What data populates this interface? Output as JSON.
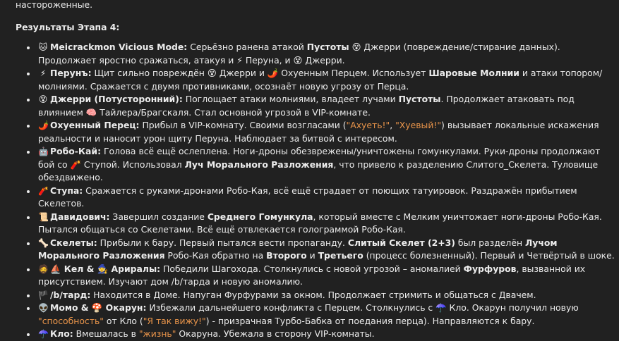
{
  "top_fragment": "настороженные.",
  "section_heading": "Результаты Этапа 4:",
  "items": [
    {
      "icon": "🐱",
      "parts": [
        {
          "t": "Meicrackmon Vicious Mode:",
          "b": true
        },
        {
          "t": " Серьёзно ранена атакой "
        },
        {
          "t": "Пустоты",
          "b": true
        },
        {
          "t": " 😵 Джерри (повреждение/стирание данных). Продолжает яростно сражаться, атакуя и ⚡ Перуна, и 😵 Джерри."
        }
      ]
    },
    {
      "icon": "⚡",
      "parts": [
        {
          "t": "Перунъ:",
          "b": true
        },
        {
          "t": " Щит сильно повреждён 😵 Джерри и 🌶️ Охуенным Перцем. Использует "
        },
        {
          "t": "Шаровые Молнии",
          "b": true
        },
        {
          "t": " и атаки топором/молниями. Сражается с двумя противниками, осознаёт новую угрозу от Перца."
        }
      ]
    },
    {
      "icon": "😵",
      "parts": [
        {
          "t": "Джерри (Потусторонний):",
          "b": true
        },
        {
          "t": " Поглощает атаки молниями, владеет лучами "
        },
        {
          "t": "Пустоты",
          "b": true
        },
        {
          "t": ". Продолжает атаковать под влиянием 🧠 Тайлера/Брагскаля. Стал основной угрозой в VIP-комнате."
        }
      ]
    },
    {
      "icon": "🌶️",
      "parts": [
        {
          "t": "Охуенный Перец:",
          "b": true
        },
        {
          "t": " Прибыл в VIP-комнату. Своими возгласами ("
        },
        {
          "t": "\"Ахуеть!\"",
          "q": true
        },
        {
          "t": ", "
        },
        {
          "t": "\"Хуевый!\"",
          "q": true
        },
        {
          "t": ") вызывает локальные искажения реальности и наносит урон щиту Перуна. Наблюдает за битвой с интересом."
        }
      ]
    },
    {
      "icon": "🤖",
      "parts": [
        {
          "t": "Робо-Кай:",
          "b": true
        },
        {
          "t": " Голова всё ещё ослеплена. Ноги-дроны обезврежены/уничтожены гомункулами. Руки-дроны продолжают бой со 🧨 Ступой. Использовал "
        },
        {
          "t": "Луч Морального Разложения",
          "b": true
        },
        {
          "t": ", что привело к разделению Слитого_Скелета. Туловище обездвижено."
        }
      ]
    },
    {
      "icon": "🧨",
      "parts": [
        {
          "t": "Ступа:",
          "b": true
        },
        {
          "t": " Сражается с руками-дронами Робо-Кая, всё ещё страдает от поющих татуировок. Раздражён прибытием Скелетов."
        }
      ]
    },
    {
      "icon": "📜",
      "parts": [
        {
          "t": "Давидович:",
          "b": true
        },
        {
          "t": " Завершил создание "
        },
        {
          "t": "Среднего Гомункула",
          "b": true
        },
        {
          "t": ", который вместе с Мелким уничтожает ноги-дроны Робо-Кая. Пытался общаться со Скелетами. Всё ещё отвлекается голограммой Робо-Кая."
        }
      ]
    },
    {
      "icon": "🦴",
      "parts": [
        {
          "t": "Скелеты:",
          "b": true
        },
        {
          "t": " Прибыли к бару. Первый пытался вести пропаганду. "
        },
        {
          "t": "Слитый Скелет (2+3)",
          "b": true
        },
        {
          "t": " был разделён "
        },
        {
          "t": "Лучом Морального Разложения",
          "b": true
        },
        {
          "t": " Робо-Кая обратно на "
        },
        {
          "t": "Второго",
          "b": true
        },
        {
          "t": " и "
        },
        {
          "t": "Третьего",
          "b": true
        },
        {
          "t": " (процесс болезненный). Первый и Четвёртый в шоке."
        }
      ]
    },
    {
      "icon": "🧔",
      "parts": [
        {
          "t": "⛵ Кел & ",
          "b": true
        },
        {
          "t": "🧙 Ариралы:",
          "b": true
        },
        {
          "t": " Победили Шагохода. Столкнулись с новой угрозой – аномалией "
        },
        {
          "t": "Фурфуров",
          "b": true
        },
        {
          "t": ", вызванной их присутствием. Изучают дом /b/тарда и новую аномалию."
        }
      ]
    },
    {
      "icon": "🏴",
      "parts": [
        {
          "t": "/b/тард:",
          "b": true
        },
        {
          "t": " Находится в Доме. Напуган Фурфурами за окном. Продолжает стримить и общаться с Двачем."
        }
      ]
    },
    {
      "icon": "👽",
      "parts": [
        {
          "t": "Момо & 🍄 Окарун:",
          "b": true
        },
        {
          "t": " Избежали дальнейшего конфликта с Перцем. Столкнулись с ☂️ Кло. Окарун получил новую "
        },
        {
          "t": "\"способность\"",
          "q": true
        },
        {
          "t": " от Кло ("
        },
        {
          "t": "\"Я так вижу!\"",
          "q": true
        },
        {
          "t": ") - призрачная Турбо-Бабка от поедания перца). Направляются к бару."
        }
      ]
    },
    {
      "icon": "☂️",
      "parts": [
        {
          "t": "Кло:",
          "b": true
        },
        {
          "t": " Вмешалась в "
        },
        {
          "t": "\"жизнь\"",
          "q": true
        },
        {
          "t": " Окаруна. Убежала в сторону VIP-комнаты."
        }
      ]
    }
  ]
}
